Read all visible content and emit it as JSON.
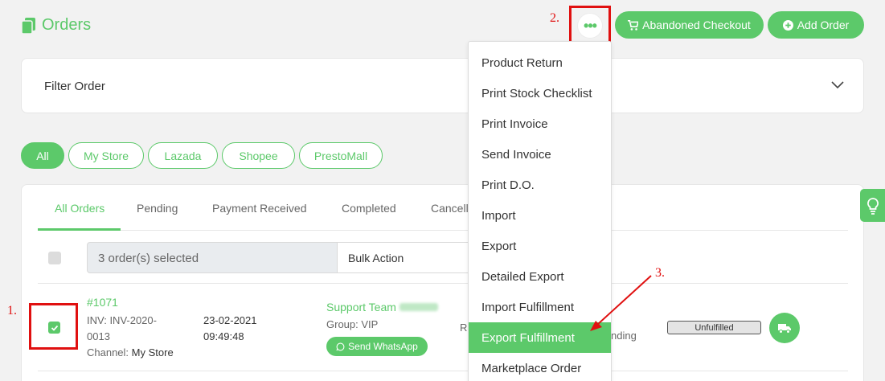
{
  "page": {
    "title": "Orders"
  },
  "header": {
    "abandoned_checkout_label": "Abandoned Checkout",
    "add_order_label": "Add Order"
  },
  "filter": {
    "title": "Filter Order"
  },
  "channels": [
    "All",
    "My Store",
    "Lazada",
    "Shopee",
    "PrestoMall"
  ],
  "tabs": [
    "All Orders",
    "Pending",
    "Payment Received",
    "Completed",
    "Cancell"
  ],
  "bulk": {
    "selected_text": "3 order(s) selected",
    "action_label": "Bulk Action"
  },
  "order": {
    "id": "#1071",
    "inv_label": "INV:",
    "inv_value": "INV-2020-0013",
    "channel_label": "Channel:",
    "channel_value": "My Store",
    "date": "23-02-2021",
    "time": "09:49:48",
    "customer": "Support Team",
    "group_label": "Group:",
    "group_value": "VIP",
    "whatsapp_label": "Send WhatsApp",
    "partial_col_a": "RI",
    "partial_col_b": "nding",
    "status": "Unfulfilled"
  },
  "dropdown": {
    "items": [
      "Product Return",
      "Print Stock Checklist",
      "Print Invoice",
      "Send Invoice",
      "Print D.O.",
      "Import",
      "Export",
      "Detailed Export",
      "Import Fulfillment",
      "Export Fulfillment",
      "Marketplace Order"
    ],
    "highlighted": "Export Fulfillment"
  },
  "annotations": {
    "marker1": "1.",
    "marker2": "2.",
    "marker3": "3."
  },
  "colors": {
    "accent": "#5cc96a",
    "annotation": "#e01010"
  },
  "icons": [
    "orders-icon",
    "more-icon",
    "cart-icon",
    "plus-circle-icon",
    "chevron-down-icon",
    "check-icon",
    "whatsapp-icon",
    "truck-icon",
    "lightbulb-icon"
  ]
}
